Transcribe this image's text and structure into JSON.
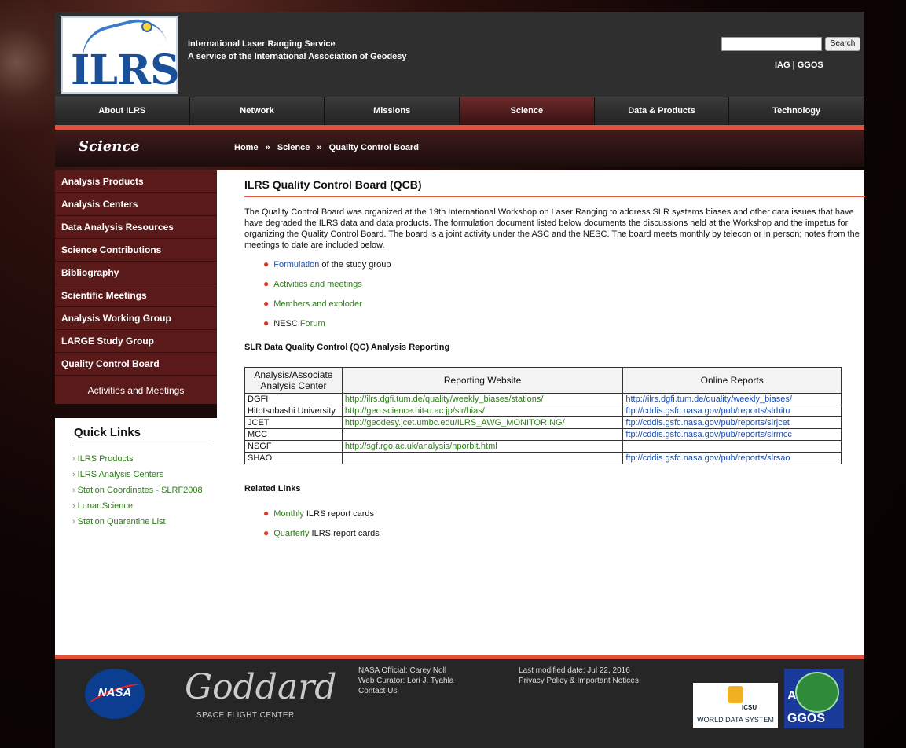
{
  "header": {
    "logo_text": "ILRS",
    "title_line1": "International Laser Ranging Service",
    "title_line2": "A service of the International Association of Geodesy",
    "search_button": "Search",
    "top_links": "IAG  |  GGOS"
  },
  "nav": {
    "items": [
      {
        "label": "About ILRS"
      },
      {
        "label": "Network"
      },
      {
        "label": "Missions"
      },
      {
        "label": "Science"
      },
      {
        "label": "Data & Products"
      },
      {
        "label": "Technology"
      }
    ]
  },
  "section": {
    "title": "Science",
    "breadcrumb": [
      "Home",
      "Science",
      "Quality Control Board"
    ],
    "breadcrumb_sep": "»"
  },
  "sidebar": {
    "items": [
      {
        "label": "Analysis Products"
      },
      {
        "label": "Analysis Centers"
      },
      {
        "label": "Data Analysis Resources"
      },
      {
        "label": "Science Contributions"
      },
      {
        "label": "Bibliography"
      },
      {
        "label": "Scientific Meetings"
      },
      {
        "label": "Analysis Working Group"
      },
      {
        "label": "LARGE Study Group"
      },
      {
        "label": "Quality Control Board"
      }
    ],
    "sub_item": "Activities and Meetings"
  },
  "quick_links": {
    "title": "Quick Links",
    "items": [
      {
        "label": "ILRS Products"
      },
      {
        "label": "ILRS Analysis Centers"
      },
      {
        "label": "Station Coordinates - SLRF2008"
      },
      {
        "label": "Lunar Science"
      },
      {
        "label": "Station Quarantine List"
      }
    ]
  },
  "main": {
    "heading": "ILRS Quality Control Board (QCB)",
    "intro": "The Quality Control Board was organized at the 19th International Workshop on Laser Ranging to address SLR systems biases and other data issues that have have degraded the ILRS data and data products. The formulation document listed below documents the discussions held at the Workshop and the impetus for organizing the Quality Control Board. The board is a joint activity under the ASC and the NESC. The board meets monthly by telecon or in person; notes from the meetings to date are included below.",
    "bullets": {
      "b1_link": "Formulation",
      "b1_text": " of the study group",
      "b2_link": "Activities and meetings",
      "b3_link": "Members and exploder",
      "b4_text": "NESC ",
      "b4_link": "Forum"
    },
    "qc_heading": "SLR Data Quality Control (QC) Analysis Reporting",
    "table": {
      "headers": [
        "Analysis/Associate Analysis Center",
        "Reporting Website",
        "Online Reports"
      ],
      "rows": [
        {
          "center": "DGFI",
          "website": "http://ilrs.dgfi.tum.de/quality/weekly_biases/stations/",
          "reports": "http://ilrs.dgfi.tum.de/quality/weekly_biases/"
        },
        {
          "center": "Hitotsubashi University",
          "website": "http://geo.science.hit-u.ac.jp/slr/bias/",
          "reports": "ftp://cddis.gsfc.nasa.gov/pub/reports/slrhitu"
        },
        {
          "center": "JCET",
          "website": "http://geodesy.jcet.umbc.edu/ILRS_AWG_MONITORING/",
          "reports": "ftp://cddis.gsfc.nasa.gov/pub/reports/slrjcet"
        },
        {
          "center": "MCC",
          "website": "",
          "reports": "ftp://cddis.gsfc.nasa.gov/pub/reports/slrmcc"
        },
        {
          "center": "NSGF",
          "website": "http://sgf.rgo.ac.uk/analysis/nporbit.html",
          "reports": ""
        },
        {
          "center": "SHAO",
          "website": "",
          "reports": "ftp://cddis.gsfc.nasa.gov/pub/reports/slrsao"
        }
      ]
    },
    "related_heading": "Related Links",
    "related": {
      "r1_link": "Monthly",
      "r1_text": " ILRS report cards",
      "r2_link": "Quarterly",
      "r2_text": " ILRS report cards"
    }
  },
  "footer": {
    "nasa_logo": "NASA",
    "goddard_logo": "Goddard",
    "goddard_sub": "SPACE FLIGHT CENTER",
    "official": "NASA Official: Carey Noll",
    "curator": "Web Curator: Lori J. Tyahla",
    "contact": "Contact Us",
    "modified": "Last modified date: Jul 22, 2016",
    "privacy": "Privacy Policy & Important Notices",
    "wds_sub": "ICSU",
    "wds_text": "WORLD DATA SYSTEM",
    "ggos_a": "A",
    "ggos_text": "GGOS"
  },
  "colors": {
    "accent_red": "#e0523c",
    "sidebar_bg": "#5a1a1a",
    "link_green": "#2e7d1a",
    "link_blue": "#1a4fb4"
  }
}
